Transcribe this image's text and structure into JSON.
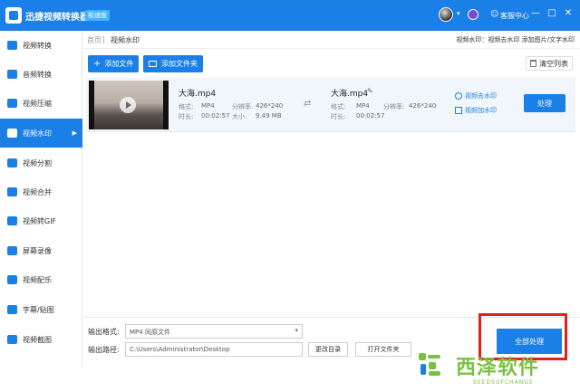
{
  "titlebar": {
    "app_title": "迅捷视频转换器",
    "edition_badge": "极速版",
    "support_label": "客服中心",
    "controls": [
      "—",
      "□",
      "✕"
    ]
  },
  "sidebar": {
    "items": [
      {
        "label": "视频转换",
        "active": false
      },
      {
        "label": "音频转换",
        "active": false
      },
      {
        "label": "视频压缩",
        "active": false
      },
      {
        "label": "视频水印",
        "active": true
      },
      {
        "label": "视频分割",
        "active": false
      },
      {
        "label": "视频合并",
        "active": false
      },
      {
        "label": "视频转GIF",
        "active": false
      },
      {
        "label": "屏幕录像",
        "active": false
      },
      {
        "label": "视频配乐",
        "active": false
      },
      {
        "label": "字幕/贴图",
        "active": false
      },
      {
        "label": "视频截图",
        "active": false
      }
    ]
  },
  "breadcrumb": {
    "home": "首页",
    "separator": "|",
    "current": "视频水印",
    "hint": "视频水印：视频去水印 添加图片/文字水印"
  },
  "toolbar": {
    "add_file": "添加文件",
    "add_folder": "添加文件夹",
    "clear_list": "清空列表"
  },
  "file": {
    "source": {
      "name": "大海.mp4",
      "format_label": "格式:",
      "format": "MP4",
      "resolution_label": "分辨率:",
      "resolution": "426*240",
      "duration_label": "时长:",
      "duration": "00:02:57",
      "size_label": "大小:",
      "size": "9.49 MB"
    },
    "output": {
      "name": "大海.mp4",
      "format_label": "格式:",
      "format": "MP4",
      "resolution_label": "分辨率:",
      "resolution": "426*240",
      "duration_label": "时长:",
      "duration": "00:02:57"
    },
    "remove_watermark": "视频去水印",
    "add_watermark": "视频加水印",
    "process": "处理"
  },
  "bottom": {
    "format_label": "输出格式:",
    "format_value": "MP4  同原文件",
    "path_label": "输出路径:",
    "path_value": "C:\\Users\\Administrator\\Desktop",
    "change_dir": "更改目录",
    "open_folder": "打开文件夹",
    "process_all": "全部处理"
  },
  "watermark": {
    "text": "西泽软件",
    "subtext": "SEEDSOFCHANGE"
  },
  "colors": {
    "primary": "#1a7fe6",
    "highlight_frame": "#e0201a",
    "watermark_green": "#7ac143"
  }
}
